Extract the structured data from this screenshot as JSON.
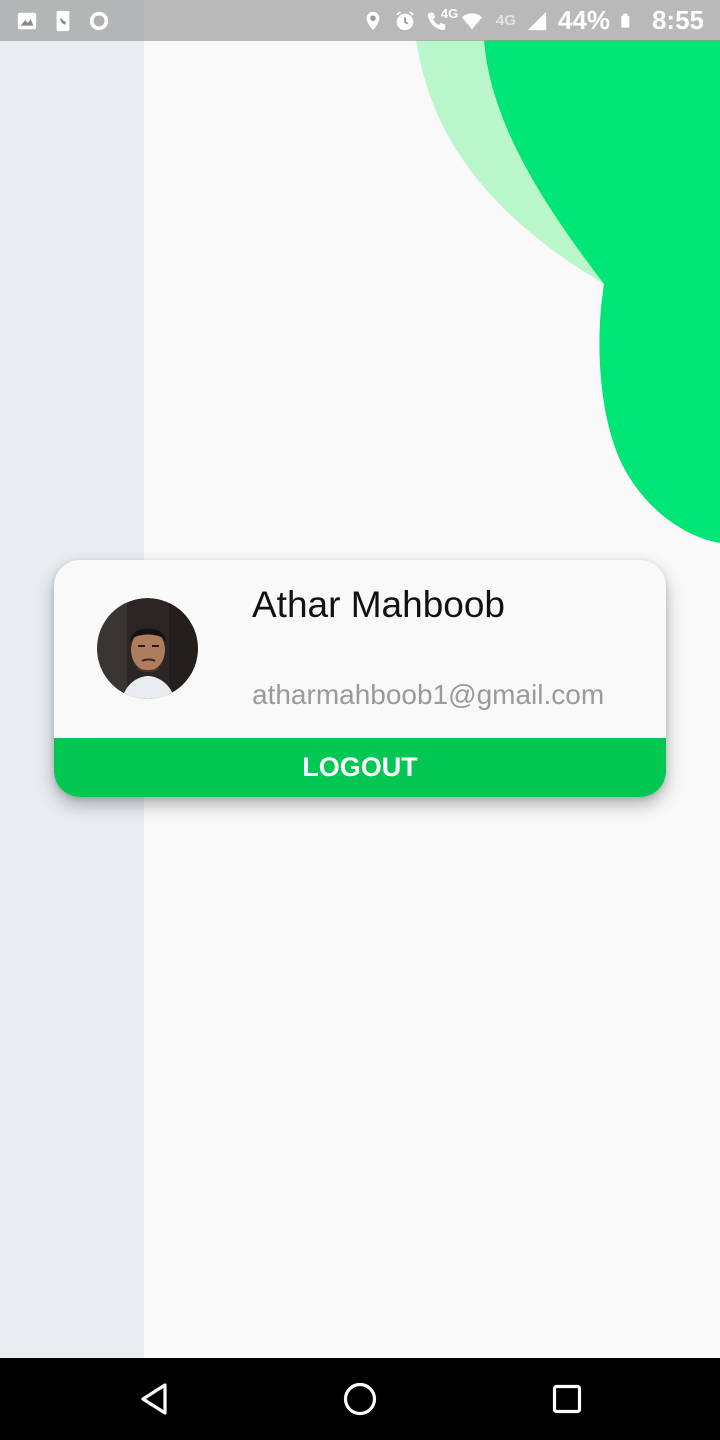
{
  "status_bar": {
    "network_label": "4G",
    "battery_percent": "44%",
    "time": "8:55",
    "left_icons": [
      "image-icon",
      "phone-icon",
      "record-icon"
    ],
    "right_icons": [
      "location-icon",
      "alarm-icon",
      "wifi-call-icon",
      "wifi-icon",
      "signal-icon",
      "battery-icon"
    ]
  },
  "profile": {
    "name": "Athar Mahboob",
    "email": "atharmahboob1@gmail.com",
    "avatar_icon": "avatar-photo"
  },
  "actions": {
    "logout_label": "LOGOUT"
  },
  "colors": {
    "accent_green": "#02c853",
    "blob_green": "#00e676",
    "blob_light_green": "#b9f6ca",
    "left_strip": "#e9edf0",
    "background": "#f9f9f9"
  },
  "nav_bar": {
    "buttons": [
      "back-icon",
      "home-icon",
      "recents-icon"
    ]
  }
}
